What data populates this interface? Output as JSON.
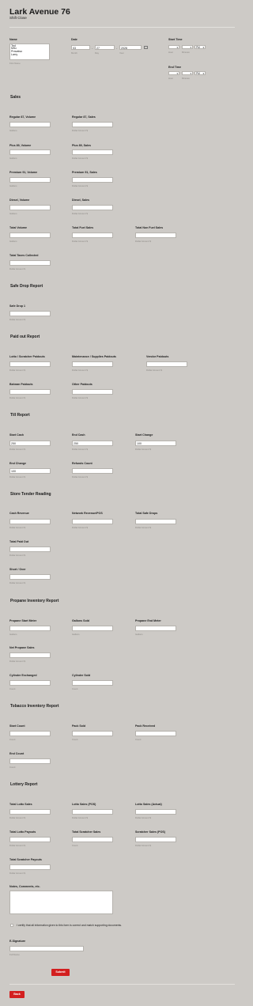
{
  "header": {
    "title": "Lark Avenue 76",
    "subtitle": "Shift Close"
  },
  "name": {
    "label": "Name",
    "options": [
      "Ted",
      "Milu",
      "Pravatso",
      "Larry"
    ],
    "sub": "First Name"
  },
  "date": {
    "label": "Date",
    "month": "03",
    "day": "27",
    "year": "2026",
    "sub_month": "Month",
    "sub_day": "Day",
    "sub_year": "Year"
  },
  "start_time": {
    "label": "Start Time",
    "hour": "",
    "minute": "",
    "ampm": "PM",
    "sub_hour": "Hour",
    "sub_minute": "Minutes"
  },
  "end_time": {
    "label": "End Time",
    "hour": "",
    "minute": "",
    "ampm": "PM",
    "sub_hour": "Hour",
    "sub_minute": "Minutes"
  },
  "sections": {
    "sales": "Sales",
    "safe_drop": "Safe Drop Report",
    "paid_out": "Paid out Report",
    "till": "Till  Report",
    "store_tender": "Store Tender Reading",
    "propane": "Propane Inventory Report",
    "tobacco": "Tobacco Inventory Report",
    "lottery": "Lottery Report"
  },
  "sales": {
    "reg_vol": {
      "label": "Regular 87, Volume",
      "sub": "Gallons"
    },
    "reg_sales": {
      "label": "Regular 87, Sales",
      "sub": "Dollar Amount $"
    },
    "plus_vol": {
      "label": "Plus 89, Volume",
      "sub": "Gallons"
    },
    "plus_sales": {
      "label": "Plus 89, Sales",
      "sub": "Dollar Amount $"
    },
    "prem_vol": {
      "label": "Premium 91, Volume",
      "sub": "Gallons"
    },
    "prem_sales": {
      "label": "Premium 91, Sales",
      "sub": "Dollar Amount $"
    },
    "diesel_vol": {
      "label": "Diesel, Volume",
      "sub": "Gallons"
    },
    "diesel_sales": {
      "label": "Diesel, Sales",
      "sub": "Dollar Amount $"
    },
    "total_vol": {
      "label": "Total Volume",
      "sub": "Gallons"
    },
    "total_fuel": {
      "label": "Total Fuel Sales",
      "sub": "Dollar Amount $"
    },
    "total_nonfuel": {
      "label": "Total Non Fuel Sales",
      "sub": "Dollar Amount $"
    },
    "total_taxes": {
      "label": "Total Taxes Collected",
      "sub": "Dollar Amount $"
    }
  },
  "safe_drop": {
    "drop1": {
      "label": "Safe Drop 1",
      "sub": "Dollar Amount $"
    }
  },
  "paid_out": {
    "lotto": {
      "label": "Lotto / Scratcher Paidouts",
      "sub": "Dollar Amount $"
    },
    "maint": {
      "label": "Maintenance / Supplies Paidouts",
      "sub": "Dollar Amount $"
    },
    "vendor": {
      "label": "Vendor Paidouts",
      "sub": "Dollar Amount $"
    },
    "bahram": {
      "label": "Bahram Paidouts",
      "sub": "Dollar Amount $"
    },
    "other": {
      "label": "Other Paidouts",
      "sub": "Dollar Amount $"
    }
  },
  "till": {
    "start_cash": {
      "label": "Start Cash",
      "value": "250",
      "sub": "Dollar Amount $"
    },
    "end_cash": {
      "label": "End Cash",
      "value": "250",
      "sub": "Dollar Amount $"
    },
    "start_change": {
      "label": "Start Change",
      "value": "100",
      "sub": "Dollar Amount $"
    },
    "end_change": {
      "label": "End Change",
      "value": "100",
      "sub": "Dollar Amount $"
    },
    "refunds": {
      "label": "Refunds Count",
      "sub": "Dollar Amount $"
    }
  },
  "store_tender": {
    "cash_rev": {
      "label": "Cash Revenue",
      "sub": "Dollar Amount $"
    },
    "network_rev": {
      "label": "Network Revenue/POS",
      "sub": "Dollar Amount $"
    },
    "total_safe": {
      "label": "Total Safe Drops",
      "sub": "Dollar Amount $"
    },
    "total_paid": {
      "label": "Total Paid Out",
      "sub": "Dollar Amount $"
    },
    "short_over": {
      "label": "Short / Over",
      "sub": "Dollar Amount $"
    }
  },
  "propane": {
    "start_meter": {
      "label": "Propane Start Meter",
      "sub": "Gallons"
    },
    "gallons_sold": {
      "label": "Gallons Sold",
      "sub": "Gallons"
    },
    "end_meter": {
      "label": "Propane End Meter",
      "sub": "Gallons"
    },
    "net_sales": {
      "label": "Net Propane Sales",
      "sub": "Dollar Amount $"
    },
    "cyl_exchanged": {
      "label": "Cylinder Exchanged",
      "sub": "Count"
    },
    "cyl_sold": {
      "label": "Cylinder Sold",
      "sub": "Count"
    }
  },
  "tobacco": {
    "start_count": {
      "label": "Start Count",
      "sub": "Count"
    },
    "pack_sold": {
      "label": "Pack Sold",
      "sub": "Count"
    },
    "pack_received": {
      "label": "Pack Received",
      "sub": "Count"
    },
    "end_count": {
      "label": "End Count",
      "sub": "Count"
    }
  },
  "lottery": {
    "total_lotto_sales": {
      "label": "Total Lotto Sales",
      "sub": "Dollar Amount $"
    },
    "lotto_pos": {
      "label": "Lotto Sales (POS)",
      "sub": "Dollar Amount $"
    },
    "lotto_actual": {
      "label": "Lotto Sales (Actual)",
      "sub": "Dollar Amount $"
    },
    "total_lotto_payouts": {
      "label": "Total Lotto Payouts",
      "sub": "Dollar Amount $"
    },
    "total_scratcher_sales": {
      "label": "Total Scratcher Sales",
      "sub": "Count"
    },
    "scratcher_pos": {
      "label": "Scratcher Sales (POS)",
      "sub": "Dollar Amount $"
    },
    "total_scratcher_payouts": {
      "label": "Total Scratcher Payouts",
      "sub": "Dollar Amount $"
    }
  },
  "notes": {
    "label": "Notes, Comments, etc."
  },
  "certify": {
    "label": "I certify that all information given to this form is correct and match supporting documents."
  },
  "signature": {
    "label": "E-Signature",
    "sub": "Full Name"
  },
  "buttons": {
    "submit": "Submit",
    "back": "Back"
  },
  "colors": {
    "background": "#cdcac6",
    "accent": "#d31f1f",
    "input_bg": "#ffffff"
  }
}
